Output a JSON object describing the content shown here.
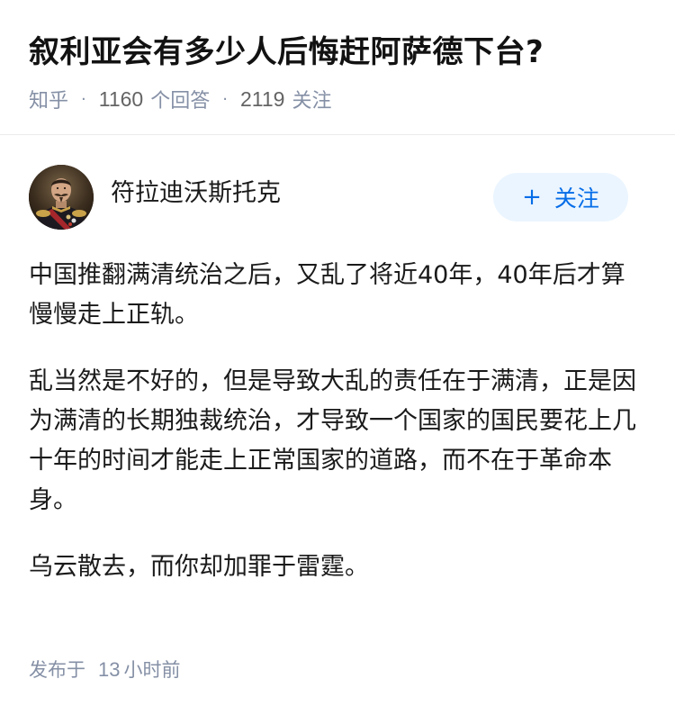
{
  "question": {
    "title": "叙利亚会有多少人后悔赶阿萨德下台?",
    "source": "知乎",
    "answer_count": "1160",
    "answer_label": "个回答",
    "follower_count": "2119",
    "follower_label": "关注",
    "separator": "·"
  },
  "author": {
    "name": "符拉迪沃斯托克",
    "avatar_icon": "portrait-avatar-icon"
  },
  "follow_button": {
    "plus": "+",
    "label": "关注"
  },
  "answer": {
    "paragraphs": [
      "中国推翻满清统治之后，又乱了将近40年，40年后才算慢慢走上正轨。",
      "乱当然是不好的，但是导致大乱的责任在于满清，正是因为满清的长期独裁统治，才导致一个国家的国民要花上几十年的时间才能走上正常国家的道路，而不在于革命本身。",
      "乌云散去，而你却加罪于雷霆。"
    ]
  },
  "footer": {
    "published_label": "发布于",
    "time_value": "13",
    "time_unit": "小时前"
  },
  "colors": {
    "meta_gray": "#8590a6",
    "follow_blue": "#056de8",
    "follow_bg": "#ebf5ff",
    "divider": "#ebebeb"
  }
}
